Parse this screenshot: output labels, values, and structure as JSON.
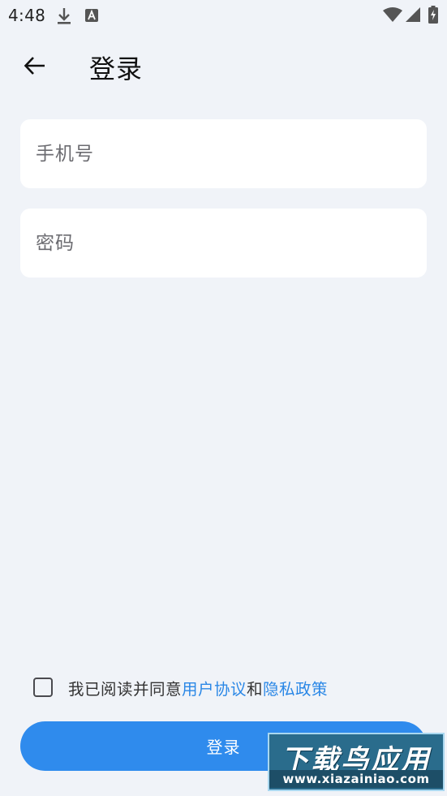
{
  "status_bar": {
    "time": "4:48",
    "icons": [
      "download-icon",
      "text-a-icon",
      "wifi-icon",
      "cell-signal-icon",
      "battery-charging-icon"
    ]
  },
  "app_bar": {
    "back_icon": "arrow-left-icon",
    "title": "登录"
  },
  "form": {
    "phone_placeholder": "手机号",
    "phone_value": "",
    "password_placeholder": "密码",
    "password_value": ""
  },
  "agreement": {
    "checked": false,
    "prefix": "我已阅读并同意",
    "user_agreement": "用户协议",
    "conjunction": "和",
    "privacy_policy": "隐私政策"
  },
  "login_button": {
    "label": "登录"
  },
  "colors": {
    "background": "#f0f3f8",
    "primary": "#2f8bed",
    "link": "#2a87e6",
    "field_bg": "#ffffff"
  },
  "watermark": {
    "title": "下载鸟应用",
    "url": "www.xiazainiao.com"
  }
}
